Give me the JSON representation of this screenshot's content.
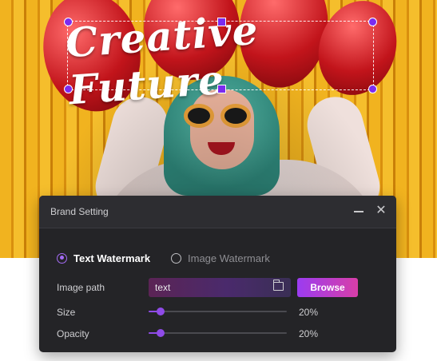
{
  "banner": {
    "headline": "Creative Future"
  },
  "dialog": {
    "title": "Brand Setting",
    "watermark_options": [
      {
        "label": "Text Watermark",
        "selected": true
      },
      {
        "label": "Image Watermark",
        "selected": false
      }
    ],
    "image_path": {
      "label": "Image path",
      "value": "text"
    },
    "browse_label": "Browse",
    "size": {
      "label": "Size",
      "value_text": "20%",
      "value": 0.2
    },
    "opacity": {
      "label": "Opacity",
      "value_text": "20%",
      "value": 0.2
    },
    "icons": [
      "minimize-icon",
      "close-icon",
      "folder-icon"
    ]
  },
  "colors": {
    "accent": "#8f4be8",
    "browse_gradient_start": "#9b3cf0",
    "browse_gradient_end": "#d83ea8",
    "dialog_bg": "#242427"
  }
}
